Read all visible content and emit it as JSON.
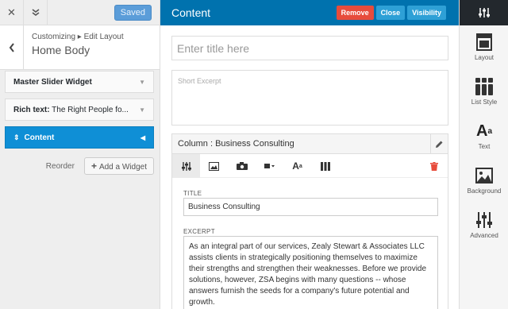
{
  "left": {
    "saved_label": "Saved",
    "breadcrumb": "Customizing ▸ Edit Layout",
    "title": "Home Body",
    "widgets": [
      {
        "name": "Master Slider Widget",
        "detail": ""
      },
      {
        "name": "Rich text:",
        "detail": " The Right People fo..."
      },
      {
        "name": "Content",
        "detail": ""
      }
    ],
    "reorder_label": "Reorder",
    "add_widget_label": "Add a Widget"
  },
  "main": {
    "title": "Content",
    "remove_label": "Remove",
    "close_label": "Close",
    "visibility_label": "Visibility",
    "title_placeholder": "Enter title here",
    "excerpt_placeholder": "Short Excerpt",
    "column_title": "Column : Business Consulting",
    "fields": {
      "title_label": "TITLE",
      "title_value": "Business Consulting",
      "excerpt_label": "EXCERPT",
      "excerpt_value": "As an integral part of our services, Zealy Stewart & Associates LLC assists clients in strategically positioning themselves to maximize their strengths and strengthen their weaknesses. Before we provide solutions, however, ZSA begins with many questions -- whose answers furnish the seeds for a company's future potential and growth."
    }
  },
  "right": {
    "items": [
      "Layout",
      "List Style",
      "Text",
      "Background",
      "Advanced"
    ]
  },
  "colors": {
    "header_blue": "#0072ae",
    "active_widget": "#0f8fd6",
    "remove_red": "#e74c3c",
    "sidebar_dark": "#23282d"
  }
}
